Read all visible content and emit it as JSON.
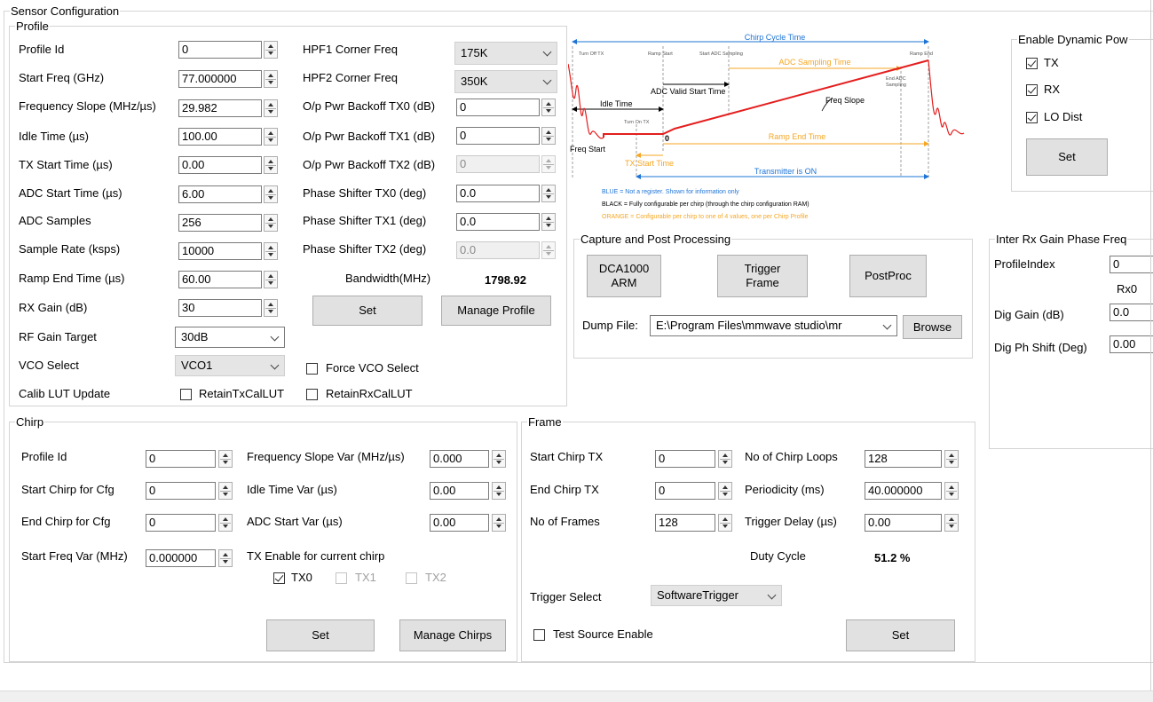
{
  "sensor_config": {
    "title": "Sensor Configuration"
  },
  "profile": {
    "title": "Profile",
    "labels": {
      "profile_id": "Profile Id",
      "start_freq": "Start Freq (GHz)",
      "freq_slope": "Frequency Slope (MHz/µs)",
      "idle_time": "Idle Time (µs)",
      "tx_start": "TX Start Time (µs)",
      "adc_start": "ADC Start Time (µs)",
      "adc_samples": "ADC Samples",
      "sample_rate": "Sample Rate (ksps)",
      "ramp_end": "Ramp End Time (µs)",
      "rx_gain": "RX Gain (dB)",
      "rf_gain_target": "RF Gain Target",
      "vco_select": "VCO Select",
      "calib_lut": "Calib LUT Update",
      "hpf1": "HPF1 Corner Freq",
      "hpf2": "HPF2 Corner Freq",
      "backoff_tx0": "O/p Pwr Backoff TX0 (dB)",
      "backoff_tx1": "O/p Pwr Backoff TX1 (dB)",
      "backoff_tx2": "O/p Pwr Backoff TX2 (dB)",
      "phase_tx0": "Phase Shifter TX0 (deg)",
      "phase_tx1": "Phase Shifter TX1 (deg)",
      "phase_tx2": "Phase Shifter TX2 (deg)",
      "bandwidth": "Bandwidth(MHz)"
    },
    "values": {
      "profile_id": "0",
      "start_freq": "77.000000",
      "freq_slope": "29.982",
      "idle_time": "100.00",
      "tx_start": "0.00",
      "adc_start": "6.00",
      "adc_samples": "256",
      "sample_rate": "10000",
      "ramp_end": "60.00",
      "rx_gain": "30",
      "rf_gain_target": "30dB",
      "vco_select": "VCO1",
      "hpf1": "175K",
      "hpf2": "350K",
      "backoff_tx0": "0",
      "backoff_tx1": "0",
      "backoff_tx2": "0",
      "phase_tx0": "0.0",
      "phase_tx1": "0.0",
      "phase_tx2": "0.0",
      "bandwidth": "1798.92"
    },
    "force_vco_label": "Force VCO Select",
    "retain_tx_label": "RetainTxCalLUT",
    "retain_rx_label": "RetainRxCalLUT",
    "set_label": "Set",
    "manage_label": "Manage Profile"
  },
  "diagram": {
    "chirp_cycle_time": "Chirp Cycle Time",
    "turn_off_tx": "Turn Off TX",
    "ramp_start": "Ramp Start",
    "start_adc_sampling": "Start ADC Sampling",
    "ramp_end": "Ramp End",
    "adc_sampling_time": "ADC Sampling Time",
    "end_adc_sampling_1": "End ADC",
    "end_adc_sampling_2": "Sampling",
    "adc_valid_start": "ADC Valid Start Time",
    "freq_slope": "Freq Slope",
    "idle_time": "Idle Time",
    "turn_on_tx": "Turn On TX",
    "zero": "0",
    "ramp_end_time": "Ramp End Time",
    "freq_start": "Freq Start",
    "tx_start_time": "TX Start Time",
    "transmitter_on": "Transmitter is ON",
    "legend_blue": "BLUE = Not a register. Shown for information only",
    "legend_black": "BLACK = Fully configurable per chirp (through the chirp configuration RAM)",
    "legend_orange": "ORANGE = Configurable per chirp to one of 4 values, one per Chirp Profile",
    "colors": {
      "blue": "#1e74d6",
      "orange": "#f5a623",
      "red": "#e41e1e",
      "black": "#000000"
    }
  },
  "dynamic_power": {
    "title": "Enable Dynamic Pow",
    "tx": "TX",
    "rx": "RX",
    "lo": "LO Dist",
    "set_label": "Set"
  },
  "capture": {
    "title": "Capture and Post Processing",
    "dca_line1": "DCA1000",
    "dca_line2": "ARM",
    "trigger_line1": "Trigger",
    "trigger_line2": "Frame",
    "postproc": "PostProc",
    "dump_label": "Dump File:",
    "dump_value": "E:\\Program Files\\mmwave studio\\mr",
    "browse": "Browse"
  },
  "inter_rx": {
    "title": "Inter Rx Gain Phase Freq",
    "profile_index_label": "ProfileIndex",
    "profile_index_value": "0",
    "rx0": "Rx0",
    "dig_gain_label": "Dig Gain (dB)",
    "dig_gain_value": "0.0",
    "dig_ph_label": "Dig Ph Shift (Deg)",
    "dig_ph_value": "0.00"
  },
  "chirp": {
    "title": "Chirp",
    "labels": {
      "profile_id": "Profile Id",
      "start_chirp": "Start Chirp for Cfg",
      "end_chirp": "End Chirp for Cfg",
      "start_freq_var": "Start Freq Var (MHz)",
      "freq_slope_var": "Frequency Slope Var (MHz/µs)",
      "idle_var": "Idle Time Var (µs)",
      "adc_var": "ADC Start Var (µs)",
      "tx_enable": "TX Enable for current chirp"
    },
    "values": {
      "profile_id": "0",
      "start_chirp": "0",
      "end_chirp": "0",
      "start_freq_var": "0.000000",
      "freq_slope_var": "0.000",
      "idle_var": "0.00",
      "adc_var": "0.00"
    },
    "tx0": "TX0",
    "tx1": "TX1",
    "tx2": "TX2",
    "set_label": "Set",
    "manage_label": "Manage Chirps"
  },
  "frame": {
    "title": "Frame",
    "labels": {
      "start_chirp_tx": "Start Chirp TX",
      "end_chirp_tx": "End Chirp TX",
      "num_frames": "No of Frames",
      "chirp_loops": "No of Chirp Loops",
      "periodicity": "Periodicity (ms)",
      "trigger_delay": "Trigger Delay (µs)",
      "duty_cycle": "Duty Cycle",
      "trigger_select": "Trigger Select"
    },
    "values": {
      "start_chirp_tx": "0",
      "end_chirp_tx": "0",
      "num_frames": "128",
      "chirp_loops": "128",
      "periodicity": "40.000000",
      "trigger_delay": "0.00",
      "duty_cycle": "51.2 %",
      "trigger_select": "SoftwareTrigger"
    },
    "test_source": "Test Source Enable",
    "set_label": "Set"
  }
}
